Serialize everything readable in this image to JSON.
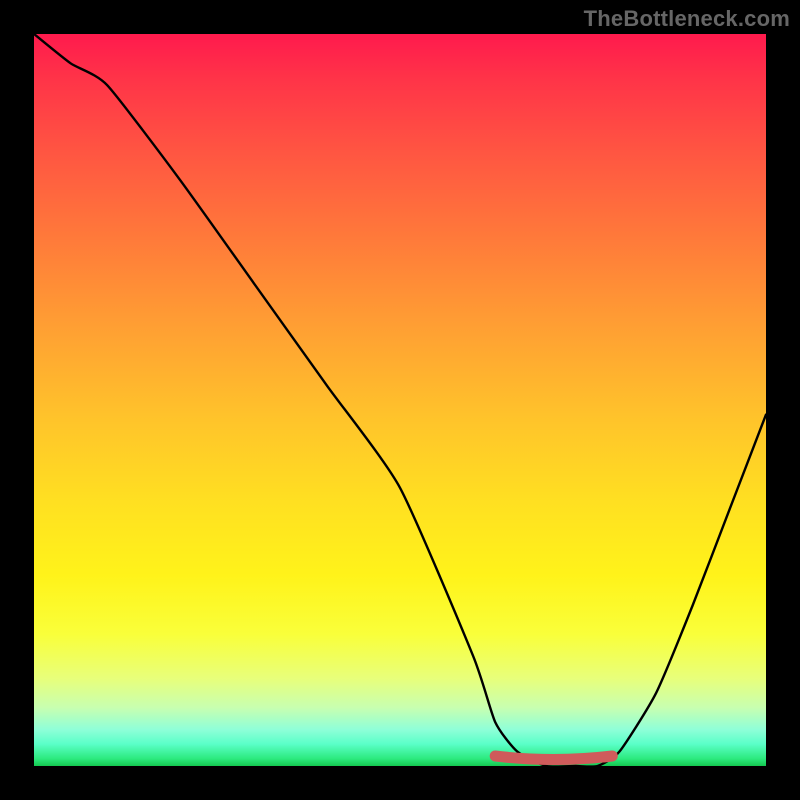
{
  "watermark": "TheBottleneck.com",
  "chart_data": {
    "type": "line",
    "title": "",
    "xlabel": "",
    "ylabel": "",
    "xlim": [
      0,
      100
    ],
    "ylim": [
      0,
      100
    ],
    "x": [
      0,
      5,
      10,
      20,
      30,
      40,
      50,
      60,
      63,
      66,
      70,
      74,
      77,
      80,
      85,
      90,
      95,
      100
    ],
    "values": [
      100,
      96,
      93,
      80,
      66,
      52,
      38,
      15,
      6,
      2,
      0,
      0,
      0,
      2,
      10,
      22,
      35,
      48
    ],
    "flat_segment": {
      "x_start": 63,
      "x_end": 79,
      "y": 0
    },
    "annotations": []
  },
  "colors": {
    "curve": "#000000",
    "flat_marker": "#cf5b5b",
    "background_black": "#000000"
  }
}
